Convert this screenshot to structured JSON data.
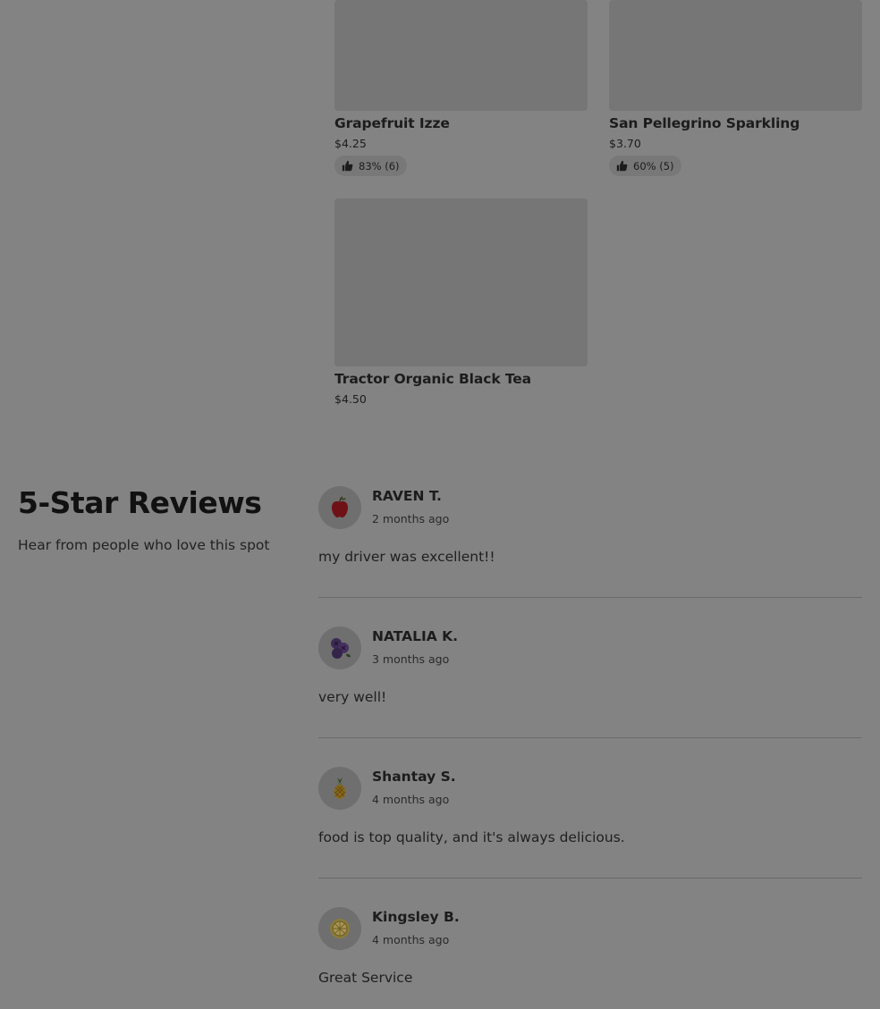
{
  "products": [
    {
      "name": "Grapefruit Izze",
      "price": "$4.25",
      "rating": "83% (6)"
    },
    {
      "name": "San Pellegrino Sparkling",
      "price": "$3.70",
      "rating": "60% (5)"
    },
    {
      "name": "Tractor Organic Black Tea",
      "price": "$4.50"
    }
  ],
  "reviews_section": {
    "title": "5-Star Reviews",
    "subtitle": "Hear from people who love this spot"
  },
  "reviews": [
    {
      "author": "RAVEN T.",
      "date": "2 months ago",
      "text": "my driver was excellent!!",
      "avatar_icon": "apple-icon"
    },
    {
      "author": "NATALIA K.",
      "date": "3 months ago",
      "text": "very well!",
      "avatar_icon": "blueberry-icon"
    },
    {
      "author": "Shantay S.",
      "date": "4 months ago",
      "text": "food is top quality, and it's always delicious.",
      "avatar_icon": "pineapple-icon"
    },
    {
      "author": "Kingsley B.",
      "date": "4 months ago",
      "text": "Great Service",
      "avatar_icon": "lemon-icon"
    }
  ],
  "colors": {
    "overlay_background": "#838383",
    "image_placeholder": "#767676",
    "rating_pill": "#787878"
  }
}
